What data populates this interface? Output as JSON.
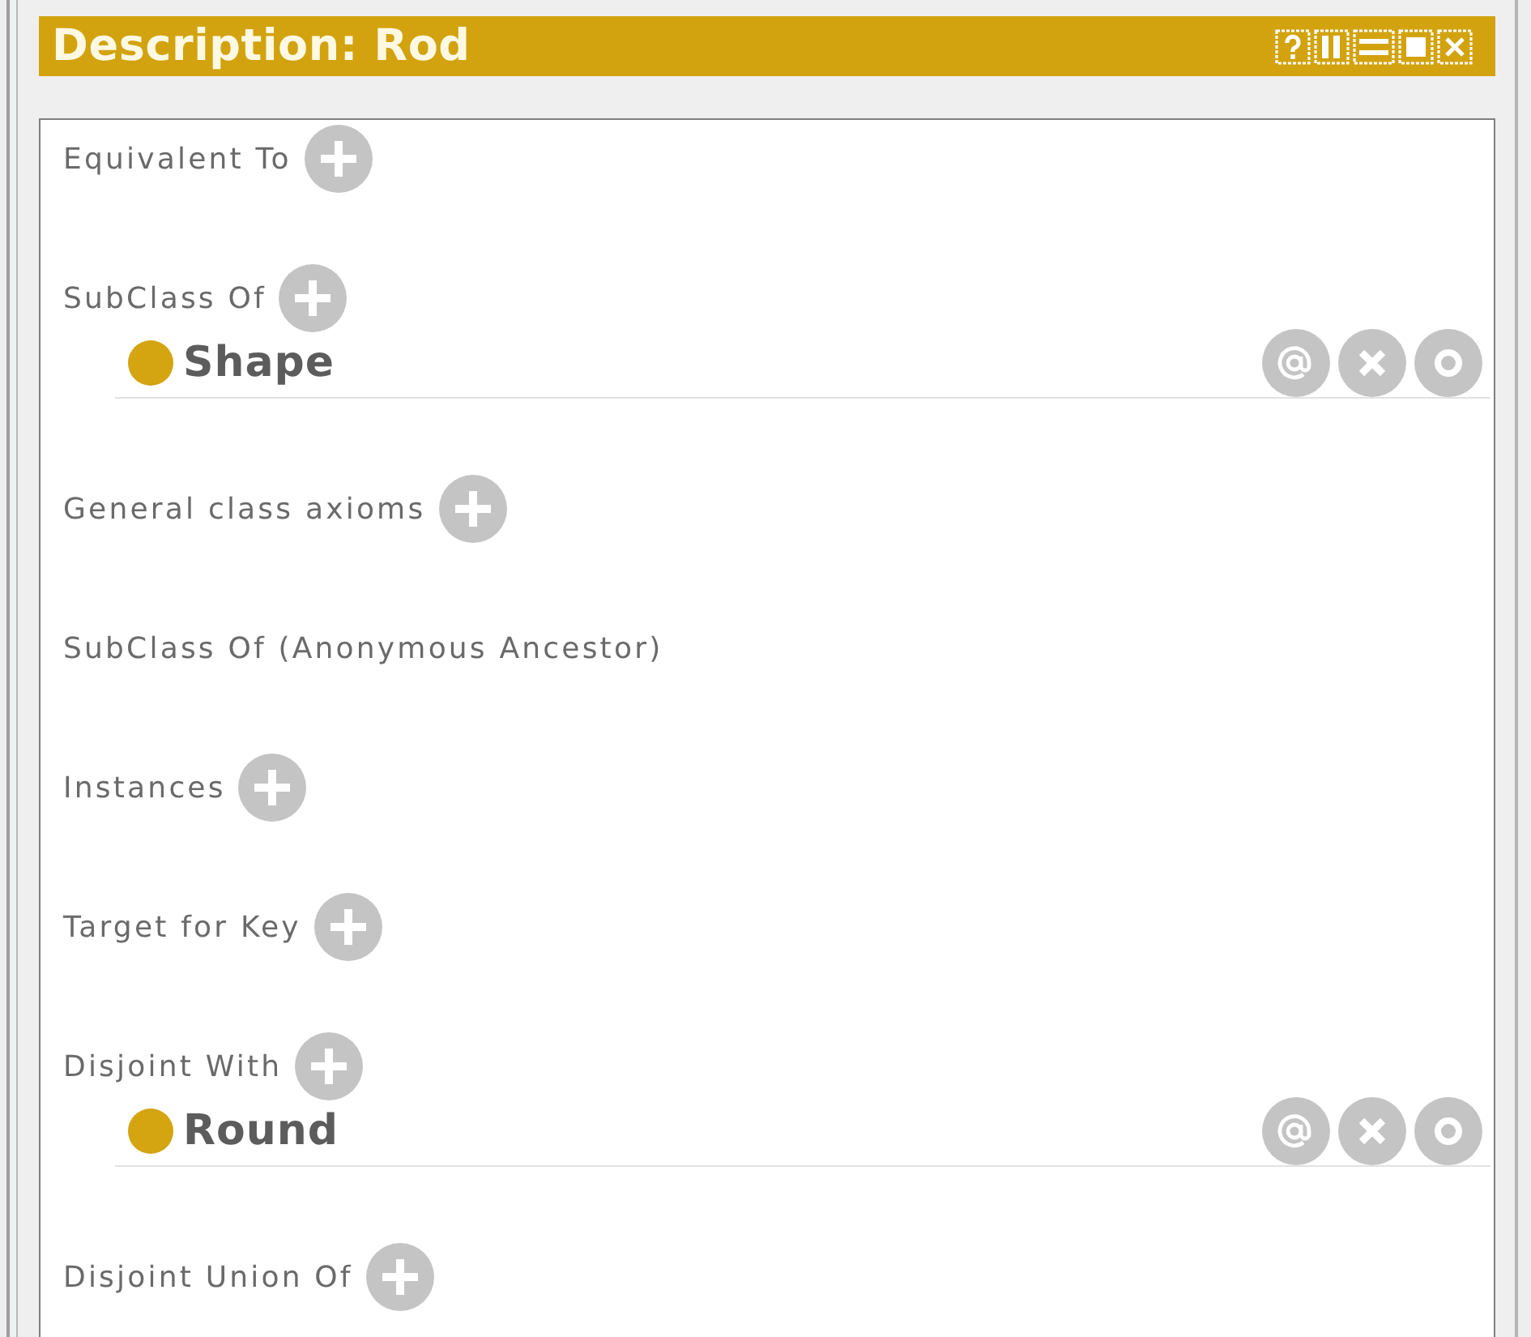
{
  "window": {
    "title": "Description: Rod"
  },
  "sections": [
    {
      "label": "Equivalent To",
      "addable": true
    },
    {
      "label": "SubClass Of",
      "addable": true,
      "items": [
        {
          "label": "Shape"
        }
      ]
    },
    {
      "label": "General class axioms",
      "addable": true
    },
    {
      "label": "SubClass Of (Anonymous Ancestor)",
      "addable": false
    },
    {
      "label": "Instances",
      "addable": true
    },
    {
      "label": "Target for Key",
      "addable": true
    },
    {
      "label": "Disjoint With",
      "addable": true,
      "items": [
        {
          "label": "Round"
        }
      ]
    },
    {
      "label": "Disjoint Union Of",
      "addable": true
    }
  ]
}
